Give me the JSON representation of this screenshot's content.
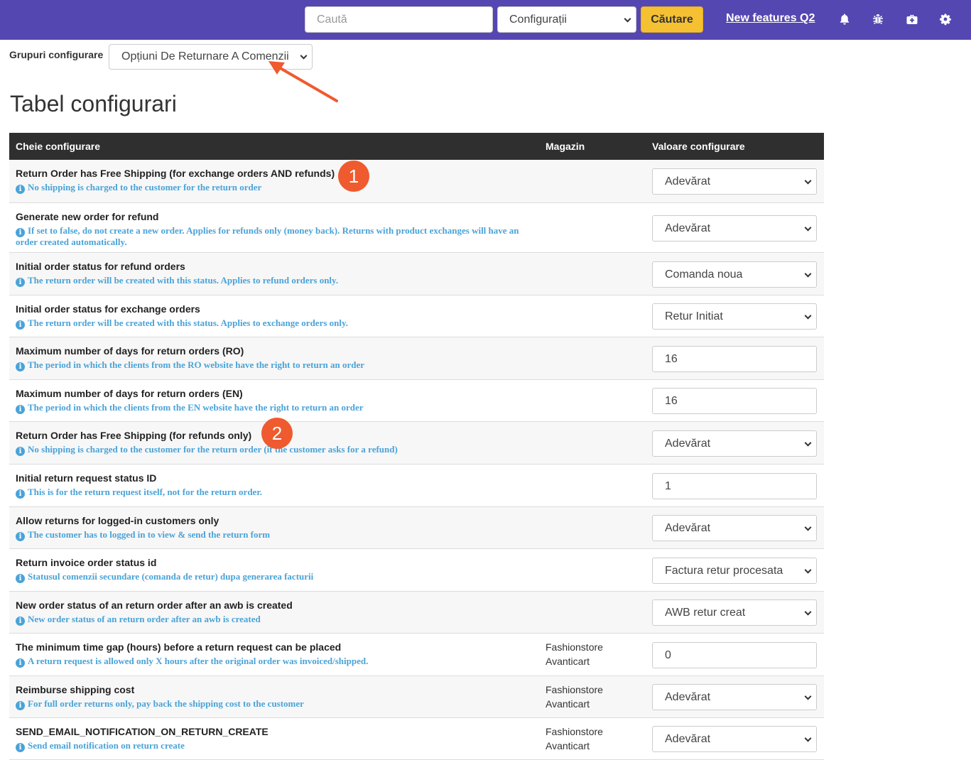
{
  "topbar": {
    "search_placeholder": "Caută",
    "scope_select": "Configurații",
    "search_button": "Căutare",
    "new_features_link": "New features Q2",
    "icons": [
      "bell-icon",
      "bug-icon",
      "medkit-icon",
      "gear-icon"
    ]
  },
  "group": {
    "label": "Grupuri configurare",
    "selected": "Opțiuni De Returnare A Comenzii"
  },
  "page_title": "Tabel configurari",
  "table": {
    "headers": {
      "key": "Cheie configurare",
      "store": "Magazin",
      "value": "Valoare configurare"
    },
    "rows": [
      {
        "title": "Return Order has Free Shipping (for exchange orders AND refunds)",
        "desc": "No shipping is charged to the customer for the return order",
        "store": [],
        "type": "select",
        "value": "Adevărat"
      },
      {
        "title": "Generate new order for refund",
        "desc": "If set to false, do not create a new order. Applies for refunds only (money back). Returns with product exchanges will have an order created automatically.",
        "store": [],
        "type": "select",
        "value": "Adevărat"
      },
      {
        "title": "Initial order status for refund orders",
        "desc": "The return order will be created with this status. Applies to refund orders only.",
        "store": [],
        "type": "select",
        "value": "Comanda noua"
      },
      {
        "title": "Initial order status for exchange orders",
        "desc": "The return order will be created with this status. Applies to exchange orders only.",
        "store": [],
        "type": "select",
        "value": "Retur Initiat"
      },
      {
        "title": "Maximum number of days for return orders (RO)",
        "desc": "The period in which the clients from the RO website have the right to return an order",
        "store": [],
        "type": "input",
        "value": "16"
      },
      {
        "title": "Maximum number of days for return orders (EN)",
        "desc": "The period in which the clients from the EN website have the right to return an order",
        "store": [],
        "type": "input",
        "value": "16"
      },
      {
        "title": "Return Order has Free Shipping (for refunds only)",
        "desc": "No shipping is charged to the customer for the return order (if the customer asks for a refund)",
        "store": [],
        "type": "select",
        "value": "Adevărat"
      },
      {
        "title": "Initial return request status ID",
        "desc": "This is for the return request itself, not for the return order.",
        "store": [],
        "type": "input",
        "value": "1"
      },
      {
        "title": "Allow returns for logged-in customers only",
        "desc": "The customer has to logged in to view & send the return form",
        "store": [],
        "type": "select",
        "value": "Adevărat"
      },
      {
        "title": "Return invoice order status id",
        "desc": "Statusul comenzii secundare (comanda de retur) dupa generarea facturii",
        "store": [],
        "type": "select",
        "value": "Factura retur procesata"
      },
      {
        "title": "New order status of an return order after an awb is created",
        "desc": "New order status of an return order after an awb is created",
        "store": [],
        "type": "select",
        "value": "AWB retur creat"
      },
      {
        "title": "The minimum time gap (hours) before a return request can be placed",
        "desc": "A return request is allowed only X hours after the original order was invoiced/shipped.",
        "store": [
          "Fashionstore",
          "Avanticart"
        ],
        "type": "input",
        "value": "0"
      },
      {
        "title": "Reimburse shipping cost",
        "desc": "For full order returns only, pay back the shipping cost to the customer",
        "store": [
          "Fashionstore",
          "Avanticart"
        ],
        "type": "select",
        "value": "Adevărat"
      },
      {
        "title": "SEND_EMAIL_NOTIFICATION_ON_RETURN_CREATE",
        "desc": "Send email notification on return create",
        "store": [
          "Fashionstore",
          "Avanticart"
        ],
        "type": "select",
        "value": "Adevărat"
      }
    ]
  },
  "annotations": {
    "badge_1": "1",
    "badge_2": "2",
    "arrow_color": "#ef5a2f"
  }
}
